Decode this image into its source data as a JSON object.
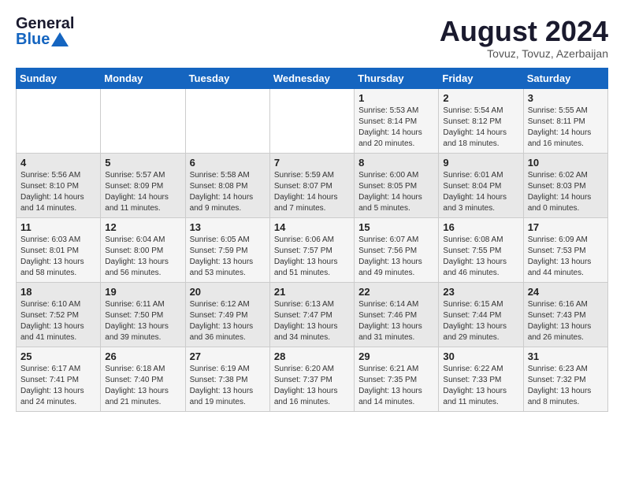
{
  "header": {
    "logo_line1": "General",
    "logo_line2": "Blue",
    "main_title": "August 2024",
    "subtitle": "Tovuz, Tovuz, Azerbaijan"
  },
  "calendar": {
    "weekdays": [
      "Sunday",
      "Monday",
      "Tuesday",
      "Wednesday",
      "Thursday",
      "Friday",
      "Saturday"
    ],
    "weeks": [
      [
        {
          "day": "",
          "info": ""
        },
        {
          "day": "",
          "info": ""
        },
        {
          "day": "",
          "info": ""
        },
        {
          "day": "",
          "info": ""
        },
        {
          "day": "1",
          "info": "Sunrise: 5:53 AM\nSunset: 8:14 PM\nDaylight: 14 hours\nand 20 minutes."
        },
        {
          "day": "2",
          "info": "Sunrise: 5:54 AM\nSunset: 8:12 PM\nDaylight: 14 hours\nand 18 minutes."
        },
        {
          "day": "3",
          "info": "Sunrise: 5:55 AM\nSunset: 8:11 PM\nDaylight: 14 hours\nand 16 minutes."
        }
      ],
      [
        {
          "day": "4",
          "info": "Sunrise: 5:56 AM\nSunset: 8:10 PM\nDaylight: 14 hours\nand 14 minutes."
        },
        {
          "day": "5",
          "info": "Sunrise: 5:57 AM\nSunset: 8:09 PM\nDaylight: 14 hours\nand 11 minutes."
        },
        {
          "day": "6",
          "info": "Sunrise: 5:58 AM\nSunset: 8:08 PM\nDaylight: 14 hours\nand 9 minutes."
        },
        {
          "day": "7",
          "info": "Sunrise: 5:59 AM\nSunset: 8:07 PM\nDaylight: 14 hours\nand 7 minutes."
        },
        {
          "day": "8",
          "info": "Sunrise: 6:00 AM\nSunset: 8:05 PM\nDaylight: 14 hours\nand 5 minutes."
        },
        {
          "day": "9",
          "info": "Sunrise: 6:01 AM\nSunset: 8:04 PM\nDaylight: 14 hours\nand 3 minutes."
        },
        {
          "day": "10",
          "info": "Sunrise: 6:02 AM\nSunset: 8:03 PM\nDaylight: 14 hours\nand 0 minutes."
        }
      ],
      [
        {
          "day": "11",
          "info": "Sunrise: 6:03 AM\nSunset: 8:01 PM\nDaylight: 13 hours\nand 58 minutes."
        },
        {
          "day": "12",
          "info": "Sunrise: 6:04 AM\nSunset: 8:00 PM\nDaylight: 13 hours\nand 56 minutes."
        },
        {
          "day": "13",
          "info": "Sunrise: 6:05 AM\nSunset: 7:59 PM\nDaylight: 13 hours\nand 53 minutes."
        },
        {
          "day": "14",
          "info": "Sunrise: 6:06 AM\nSunset: 7:57 PM\nDaylight: 13 hours\nand 51 minutes."
        },
        {
          "day": "15",
          "info": "Sunrise: 6:07 AM\nSunset: 7:56 PM\nDaylight: 13 hours\nand 49 minutes."
        },
        {
          "day": "16",
          "info": "Sunrise: 6:08 AM\nSunset: 7:55 PM\nDaylight: 13 hours\nand 46 minutes."
        },
        {
          "day": "17",
          "info": "Sunrise: 6:09 AM\nSunset: 7:53 PM\nDaylight: 13 hours\nand 44 minutes."
        }
      ],
      [
        {
          "day": "18",
          "info": "Sunrise: 6:10 AM\nSunset: 7:52 PM\nDaylight: 13 hours\nand 41 minutes."
        },
        {
          "day": "19",
          "info": "Sunrise: 6:11 AM\nSunset: 7:50 PM\nDaylight: 13 hours\nand 39 minutes."
        },
        {
          "day": "20",
          "info": "Sunrise: 6:12 AM\nSunset: 7:49 PM\nDaylight: 13 hours\nand 36 minutes."
        },
        {
          "day": "21",
          "info": "Sunrise: 6:13 AM\nSunset: 7:47 PM\nDaylight: 13 hours\nand 34 minutes."
        },
        {
          "day": "22",
          "info": "Sunrise: 6:14 AM\nSunset: 7:46 PM\nDaylight: 13 hours\nand 31 minutes."
        },
        {
          "day": "23",
          "info": "Sunrise: 6:15 AM\nSunset: 7:44 PM\nDaylight: 13 hours\nand 29 minutes."
        },
        {
          "day": "24",
          "info": "Sunrise: 6:16 AM\nSunset: 7:43 PM\nDaylight: 13 hours\nand 26 minutes."
        }
      ],
      [
        {
          "day": "25",
          "info": "Sunrise: 6:17 AM\nSunset: 7:41 PM\nDaylight: 13 hours\nand 24 minutes."
        },
        {
          "day": "26",
          "info": "Sunrise: 6:18 AM\nSunset: 7:40 PM\nDaylight: 13 hours\nand 21 minutes."
        },
        {
          "day": "27",
          "info": "Sunrise: 6:19 AM\nSunset: 7:38 PM\nDaylight: 13 hours\nand 19 minutes."
        },
        {
          "day": "28",
          "info": "Sunrise: 6:20 AM\nSunset: 7:37 PM\nDaylight: 13 hours\nand 16 minutes."
        },
        {
          "day": "29",
          "info": "Sunrise: 6:21 AM\nSunset: 7:35 PM\nDaylight: 13 hours\nand 14 minutes."
        },
        {
          "day": "30",
          "info": "Sunrise: 6:22 AM\nSunset: 7:33 PM\nDaylight: 13 hours\nand 11 minutes."
        },
        {
          "day": "31",
          "info": "Sunrise: 6:23 AM\nSunset: 7:32 PM\nDaylight: 13 hours\nand 8 minutes."
        }
      ]
    ]
  }
}
